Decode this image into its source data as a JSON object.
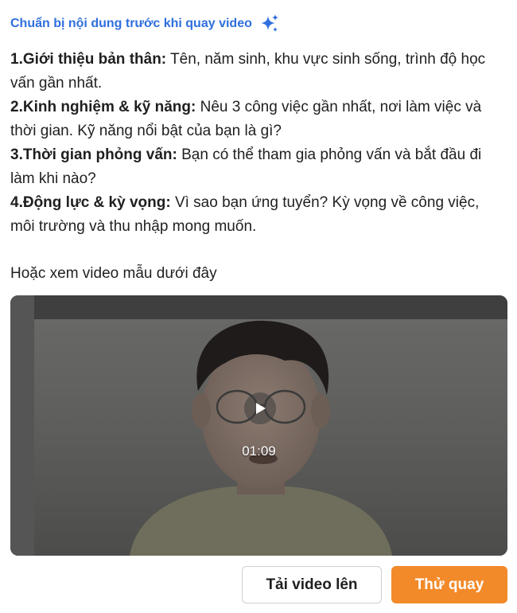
{
  "header": {
    "title": "Chuẩn bị nội dung trước khi quay video",
    "icon": "sparkle-icon",
    "accent_color": "#2f6fde"
  },
  "tips": [
    {
      "label": "1.Giới thiệu bản thân:",
      "text": " Tên, năm sinh, khu vực sinh sống, trình độ học vấn gần nhất."
    },
    {
      "label": "2.Kinh nghiệm & kỹ năng:",
      "text": " Nêu 3 công việc gần nhất, nơi làm việc và thời gian. Kỹ năng nổi bật của bạn là gì?"
    },
    {
      "label": "3.Thời gian phỏng vấn:",
      "text": " Bạn có thể tham gia phỏng vấn và bắt đầu đi làm khi nào?"
    },
    {
      "label": "4.Động lực & kỳ vọng:",
      "text": " Vì sao bạn ứng tuyển? Kỳ vọng về công việc, môi trường và thu nhập mong muốn."
    }
  ],
  "sample": {
    "label": "Hoặc xem video mẫu dưới đây",
    "duration": "01:09",
    "play_icon": "play-icon"
  },
  "actions": {
    "upload_label": "Tải video lên",
    "try_label": "Thử quay",
    "primary_color": "#f28a29"
  }
}
